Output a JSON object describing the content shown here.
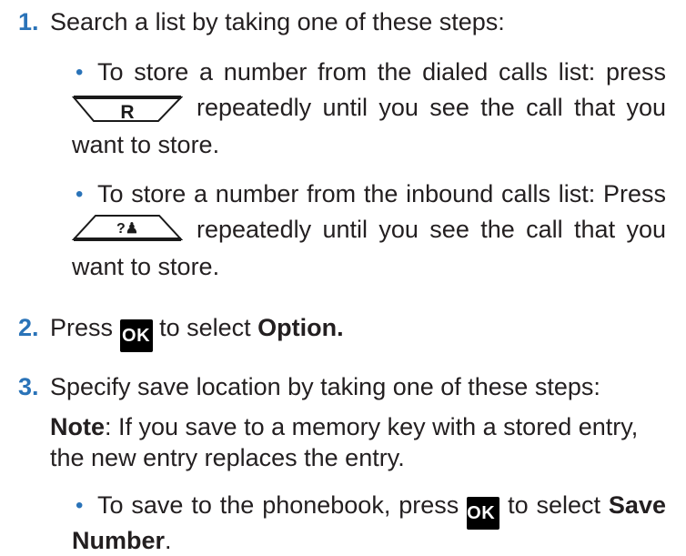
{
  "steps": {
    "s1": {
      "num": "1.",
      "text": "Search a list by taking one of these steps:",
      "b1": {
        "l1": "To store a number from the dialed calls list: press",
        "l2": "repeatedly until you see the call that you",
        "l3": "want to store."
      },
      "b2": {
        "l1": "To store a number from the inbound calls list: Press",
        "l2": "repeatedly until you see the call that you",
        "l3": "want to store."
      }
    },
    "s2": {
      "num": "2.",
      "pre": "Press",
      "mid": "to select",
      "bold": "Option."
    },
    "s3": {
      "num": "3.",
      "text": "Specify save location by taking one of these steps:",
      "note_label": "Note",
      "note_l1": ": If you save to a memory key with a stored entry,",
      "note_l2": "the new entry replaces the entry.",
      "b1": {
        "pre": "To save to the phonebook, press",
        "mid": "to select",
        "bold1": "Save",
        "bold2": "Number",
        "end": "."
      }
    }
  },
  "keys": {
    "redial_letter": "R",
    "ok_label": "OK",
    "callerid_glyph": "?♟"
  },
  "colors": {
    "accent": "#2a73b8",
    "text": "#231f20"
  }
}
